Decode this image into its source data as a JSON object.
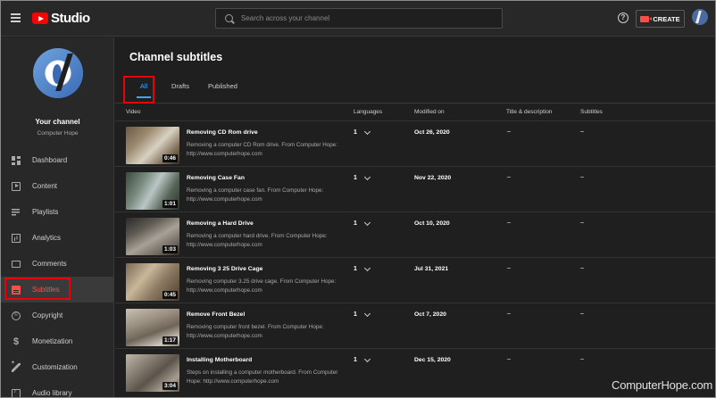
{
  "app": {
    "logo_text": "Studio",
    "search_placeholder": "Search across your channel",
    "create_label": "CREATE",
    "help_glyph": "?"
  },
  "channel": {
    "title": "Your channel",
    "name": "Computer Hope"
  },
  "sidebar": {
    "items": [
      {
        "label": "Dashboard",
        "icon": "dashboard-icon",
        "active": false
      },
      {
        "label": "Content",
        "icon": "content-icon",
        "active": false
      },
      {
        "label": "Playlists",
        "icon": "playlists-icon",
        "active": false
      },
      {
        "label": "Analytics",
        "icon": "analytics-icon",
        "active": false
      },
      {
        "label": "Comments",
        "icon": "comments-icon",
        "active": false
      },
      {
        "label": "Subtitles",
        "icon": "subtitles-icon",
        "active": true
      },
      {
        "label": "Copyright",
        "icon": "copyright-icon",
        "active": false
      },
      {
        "label": "Monetization",
        "icon": "monetization-icon",
        "active": false
      },
      {
        "label": "Customization",
        "icon": "customization-icon",
        "active": false
      },
      {
        "label": "Audio library",
        "icon": "audio-library-icon",
        "active": false
      }
    ]
  },
  "main": {
    "title": "Channel subtitles",
    "tabs": [
      {
        "label": "All",
        "active": true
      },
      {
        "label": "Drafts",
        "active": false
      },
      {
        "label": "Published",
        "active": false
      }
    ],
    "columns": {
      "video": "Video",
      "languages": "Languages",
      "modified": "Modified on",
      "title_desc": "Title & description",
      "subtitles": "Subtitles"
    },
    "videos": [
      {
        "title": "Removing CD Rom drive",
        "desc": "Removing a computer CD Rom drive. From Computer Hope: http://www.computerhope.com",
        "duration": "0:46",
        "languages": "1",
        "modified": "Oct 26, 2020",
        "title_desc": "–",
        "subtitles": "–"
      },
      {
        "title": "Removing Case Fan",
        "desc": "Removing a computer case fan. From Computer Hope: http://www.computerhope.com",
        "duration": "1:01",
        "languages": "1",
        "modified": "Nov 22, 2020",
        "title_desc": "–",
        "subtitles": "–"
      },
      {
        "title": "Removing a Hard Drive",
        "desc": "Removing a computer hard drive. From Computer Hope: http://www.computerhope.com",
        "duration": "1:03",
        "languages": "1",
        "modified": "Oct 10, 2020",
        "title_desc": "–",
        "subtitles": "–"
      },
      {
        "title": "Removing 3 25 Drive Cage",
        "desc": "Removing computer 3.25 drive cage. From Computer Hope: http://www.computerhope.com",
        "duration": "0:45",
        "languages": "1",
        "modified": "Jul 31, 2021",
        "title_desc": "–",
        "subtitles": "–"
      },
      {
        "title": "Remove Front Bezel",
        "desc": "Removing computer front bezel. From Computer Hope: http://www.computerhope.com",
        "duration": "1:17",
        "languages": "1",
        "modified": "Oct 7, 2020",
        "title_desc": "–",
        "subtitles": "–"
      },
      {
        "title": "Installing Motherboard",
        "desc": "Steps on installing a computer motherboard. From Computer Hope: http://www.computerhope.com",
        "duration": "3:04",
        "languages": "1",
        "modified": "Dec 15, 2020",
        "title_desc": "–",
        "subtitles": "–"
      }
    ]
  },
  "watermark": "ComputerHope.com",
  "colors": {
    "accent_red": "#ff0000",
    "highlight_red": "#e8000b",
    "tab_blue": "#3ea6ff",
    "active_nav": "#ff4e45"
  }
}
